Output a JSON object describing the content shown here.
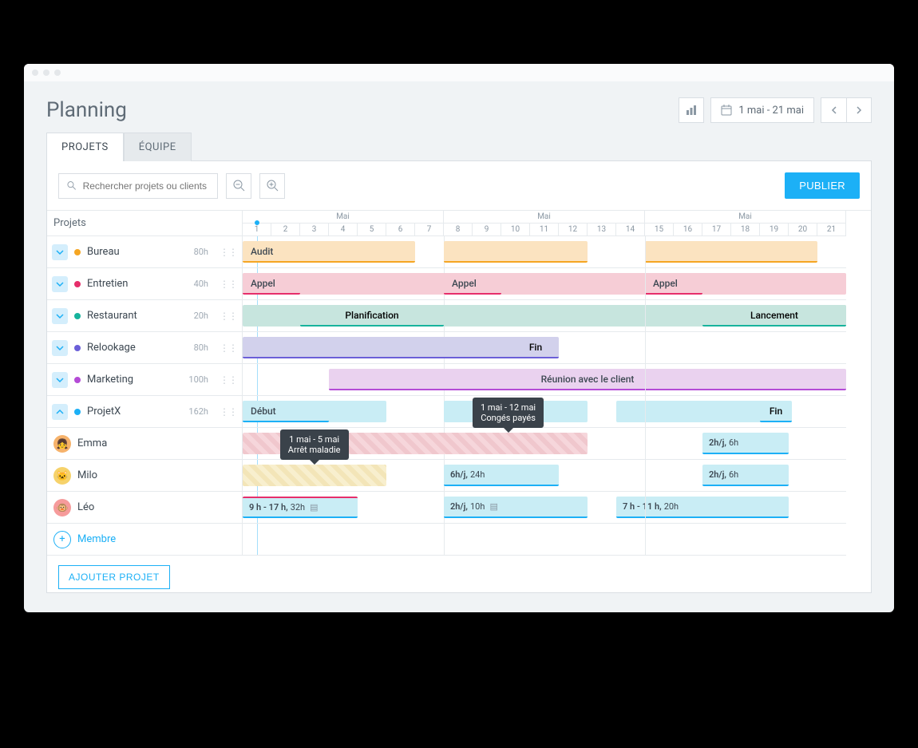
{
  "page_title": "Planning",
  "date_range": "1 mai - 21 mai",
  "tabs": [
    "PROJETS",
    "ÉQUIPE"
  ],
  "search_placeholder": "Rechercher projets ou clients",
  "publish_label": "PUBLIER",
  "column_header": "Projets",
  "month_label": "Mai",
  "days": [
    "1",
    "2",
    "3",
    "4",
    "5",
    "6",
    "7",
    "8",
    "9",
    "10",
    "11",
    "12",
    "13",
    "14",
    "15",
    "16",
    "17",
    "18",
    "19",
    "20",
    "21"
  ],
  "projects": [
    {
      "name": "Bureau",
      "hours": "80h",
      "color": "#f5a623",
      "bars": [
        {
          "label": "Audit"
        }
      ]
    },
    {
      "name": "Entretien",
      "hours": "40h",
      "color": "#e62e6b",
      "bars": [
        {
          "label": "Appel"
        },
        {
          "label": "Appel"
        },
        {
          "label": "Appel"
        }
      ]
    },
    {
      "name": "Restaurant",
      "hours": "20h",
      "color": "#17b39c",
      "milestones": [
        {
          "label": "Planification"
        },
        {
          "label": "Lancement"
        }
      ]
    },
    {
      "name": "Relookage",
      "hours": "80h",
      "color": "#6b5fd8",
      "milestones": [
        {
          "label": "Fin"
        }
      ]
    },
    {
      "name": "Marketing",
      "hours": "100h",
      "color": "#b44bd6",
      "milestones": [
        {
          "label": "Réunion avec le client"
        }
      ]
    },
    {
      "name": "ProjetX",
      "hours": "162h",
      "color": "#1cb0f6",
      "expanded": true,
      "milestones": [
        {
          "label": "Début"
        },
        {
          "label": "Fin"
        }
      ]
    }
  ],
  "members": [
    {
      "name": "Emma",
      "allocations": [
        {
          "label_bold": "2h/j,",
          "label_rest": "6h"
        }
      ],
      "leave": {
        "range": "1 mai - 12 mai",
        "label": "Congés payés"
      }
    },
    {
      "name": "Milo",
      "allocations": [
        {
          "label_bold": "6h/j,",
          "label_rest": "24h"
        },
        {
          "label_bold": "2h/j,",
          "label_rest": "6h"
        }
      ],
      "sick": {
        "range": "1 mai - 5 mai",
        "label": "Arrêt maladie"
      }
    },
    {
      "name": "Léo",
      "allocations": [
        {
          "label_bold": "9 h - 17 h,",
          "label_rest": "32h",
          "note": true
        },
        {
          "label_bold": "2h/j,",
          "label_rest": "10h",
          "note": true
        },
        {
          "label_bold": "7 h - 11 h,",
          "label_rest": "20h"
        }
      ]
    }
  ],
  "add_member_label": "Membre",
  "add_project_label": "AJOUTER PROJET",
  "colors": {
    "orange_bg": "#fbe3c0",
    "orange_edge": "#f5a623",
    "pink_bg": "#f6cdd6",
    "pink_edge": "#e62e6b",
    "teal_bg": "#c7e5de",
    "teal_edge": "#17b39c",
    "violet_bg": "#d2d1ec",
    "violet_edge": "#6b5fd8",
    "purple_bg": "#ead2ef",
    "purple_edge": "#b44bd6",
    "cyan_bg": "#c9edf5",
    "cyan_edge": "#1cb0f6"
  }
}
